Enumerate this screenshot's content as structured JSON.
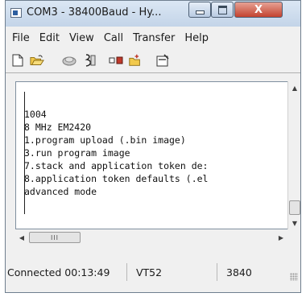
{
  "window": {
    "title": "COM3 - 38400Baud - Hy...",
    "close_glyph": "X"
  },
  "menu": {
    "items": [
      "File",
      "Edit",
      "View",
      "Call",
      "Transfer",
      "Help"
    ]
  },
  "toolbar": {
    "icons": [
      "new-icon",
      "open-icon",
      "disconnect-icon",
      "call-icon",
      "send-receive-icon",
      "new-connection-icon",
      "properties-icon"
    ]
  },
  "terminal": {
    "lines": [
      "1004",
      "8 MHz EM2420",
      "1.program upload (.bin image)",
      "3.run program image",
      "7.stack and application token de:",
      "8.application token defaults (.el",
      "advanced mode"
    ]
  },
  "scrollbars": {
    "horizontal_thumb_grip": "III"
  },
  "status": {
    "connection": "Connected 00:13:49",
    "emulation": "VT52",
    "speed": "3840"
  }
}
